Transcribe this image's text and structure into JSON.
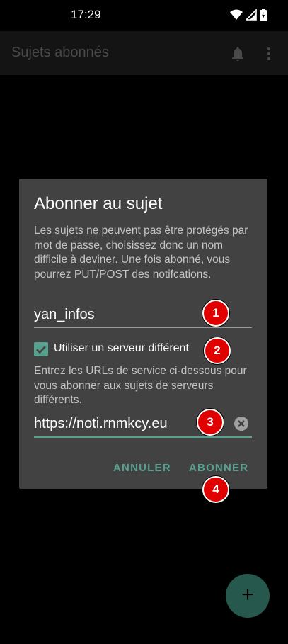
{
  "status": {
    "time": "17:29"
  },
  "appbar": {
    "title": "Sujets abonnés",
    "bell_icon": "bell-icon",
    "more_icon": "more-vert-icon"
  },
  "dialog": {
    "title": "Abonner au sujet",
    "description": "Les sujets ne peuvent pas être protégés par mot de passe, choisissez donc un nom difficile à deviner. Une fois abonné, vous pourrez PUT/POST des notifcations.",
    "topic_value": "yan_infos",
    "checkbox_label": "Utiliser un serveur différent",
    "checkbox_checked": true,
    "server_description": "Entrez les URLs de service ci-dessous pour vous abonner aux sujets de serveurs différents.",
    "server_value": "https://noti.rnmkcy.eu",
    "cancel_label": "ANNULER",
    "subscribe_label": "ABONNER"
  },
  "markers": [
    "1",
    "2",
    "3",
    "4"
  ],
  "fab": {
    "label": "+"
  },
  "colors": {
    "accent": "#58a18f",
    "dialog_bg": "#424242",
    "marker": "#e00000",
    "fab": "#27584d"
  }
}
